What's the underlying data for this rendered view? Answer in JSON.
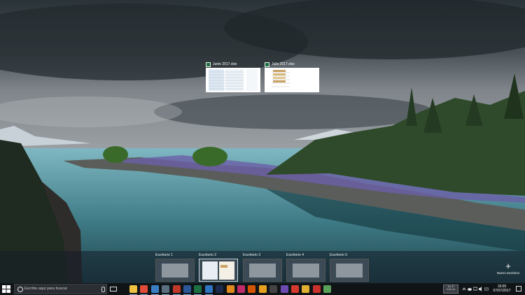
{
  "windows": [
    {
      "title": "Junio 2017.xlsx",
      "icon": "excel-icon"
    },
    {
      "title": "Julio 2017.xlsx",
      "icon": "excel-icon"
    }
  ],
  "virtual_desktops": [
    {
      "label": "Escritorio 1"
    },
    {
      "label": "Escritorio 2",
      "active": true
    },
    {
      "label": "Escritorio 3"
    },
    {
      "label": "Escritorio 4"
    },
    {
      "label": "Escritorio 5"
    }
  ],
  "new_desktop": {
    "icon": "plus-icon",
    "label": "Nuevo escritorio"
  },
  "taskbar": {
    "search_placeholder": "Escribe aquí para buscar",
    "apps": [
      {
        "name": "file-explorer-icon",
        "color": "#f0c040"
      },
      {
        "name": "chrome-icon",
        "color": "#e04b3a"
      },
      {
        "name": "vmware-icon",
        "color": "#3a7fc4"
      },
      {
        "name": "app-icon",
        "color": "#5a6e80"
      },
      {
        "name": "filezilla-icon",
        "color": "#c0392b"
      },
      {
        "name": "word-icon",
        "color": "#2b5797"
      },
      {
        "name": "excel-icon",
        "color": "#1d7044"
      },
      {
        "name": "outlook-icon",
        "color": "#2f74c0"
      },
      {
        "name": "photoshop-icon",
        "color": "#1b2a4a"
      },
      {
        "name": "illustrator-icon",
        "color": "#e08a1e"
      },
      {
        "name": "indesign-icon",
        "color": "#c02b6a"
      },
      {
        "name": "app-icon",
        "color": "#d35400"
      },
      {
        "name": "app-icon",
        "color": "#e6a020"
      },
      {
        "name": "app-icon",
        "color": "#444444"
      },
      {
        "name": "app-icon",
        "color": "#6a4ab0"
      },
      {
        "name": "app-icon",
        "color": "#d63a2f"
      },
      {
        "name": "app-icon",
        "color": "#e0b030"
      },
      {
        "name": "app-icon",
        "color": "#c8322a"
      },
      {
        "name": "app-icon",
        "color": "#5aa05a"
      }
    ],
    "tray_box": [
      "A L E",
      "G A L A"
    ],
    "time": "16:00",
    "date": "07/07/2017"
  }
}
